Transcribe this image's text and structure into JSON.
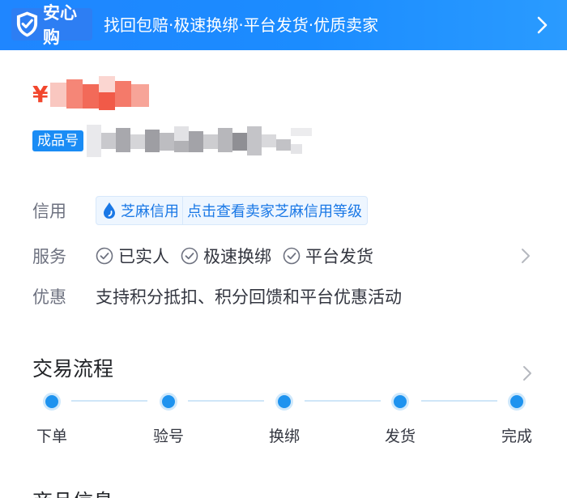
{
  "banner": {
    "badge_label": "安心购",
    "text": "找回包赔·极速换绑·平台发货·优质卖家"
  },
  "price": {
    "currency_symbol": "¥"
  },
  "product": {
    "tag": "成品号"
  },
  "credit": {
    "label": "信用",
    "name": "芝麻信用",
    "link": "点击查看卖家芝麻信用等级"
  },
  "service": {
    "label": "服务",
    "items": [
      "已实人",
      "极速换绑",
      "平台发货"
    ]
  },
  "promo": {
    "label": "优惠",
    "text": "支持积分抵扣、积分回馈和平台优惠活动"
  },
  "process": {
    "title": "交易流程",
    "steps": [
      "下单",
      "验号",
      "换绑",
      "发货",
      "完成"
    ]
  },
  "next_section": {
    "title": "商品信息"
  },
  "colors": {
    "brand_blue": "#1f86ff",
    "price_red": "#f2462d",
    "link_blue": "#1a78e6",
    "step_dot": "#1e93ef"
  }
}
